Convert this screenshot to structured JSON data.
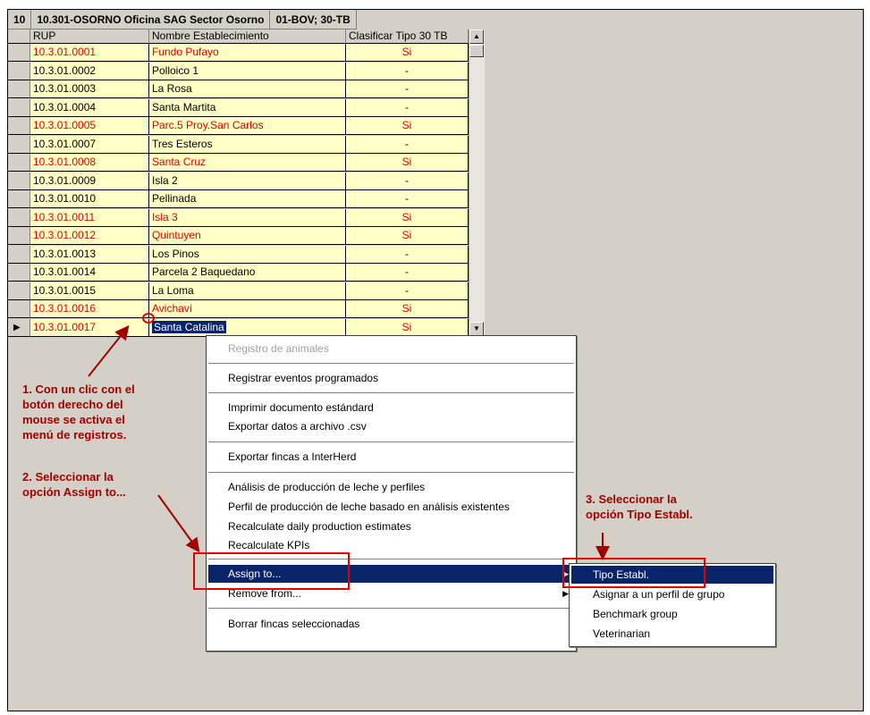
{
  "header": {
    "num": "10",
    "office": "10.301-OSORNO Oficina SAG Sector Osorno",
    "species": "01-BOV; 30-TB"
  },
  "grid": {
    "columns": [
      "RUP",
      "Nombre Establecimiento",
      "Clasificar Tipo 30 TB"
    ],
    "rows": [
      {
        "rup": "10.3.01.0001",
        "name": "Fundo Pufayo",
        "tipo": "Si",
        "color": "#e00000"
      },
      {
        "rup": "10.3.01.0002",
        "name": "Polloico 1",
        "tipo": "-",
        "color": "#000000"
      },
      {
        "rup": "10.3.01.0003",
        "name": "La Rosa",
        "tipo": "-",
        "color": "#000000"
      },
      {
        "rup": "10.3.01.0004",
        "name": "Santa Martita",
        "tipo": "-",
        "color": "#000000"
      },
      {
        "rup": "10.3.01.0005",
        "name": "Parc.5 Proy.San Carlos",
        "tipo": "Si",
        "color": "#e00000"
      },
      {
        "rup": "10.3.01.0007",
        "name": "Tres Esteros",
        "tipo": "-",
        "color": "#000000"
      },
      {
        "rup": "10.3.01.0008",
        "name": "Santa Cruz",
        "tipo": "Si",
        "color": "#e00000"
      },
      {
        "rup": "10.3.01.0009",
        "name": "Isla 2",
        "tipo": "-",
        "color": "#000000"
      },
      {
        "rup": "10.3.01.0010",
        "name": "Pellinada",
        "tipo": "-",
        "color": "#000000"
      },
      {
        "rup": "10.3.01.0011",
        "name": "Isla 3",
        "tipo": "Si",
        "color": "#e00000"
      },
      {
        "rup": "10.3.01.0012",
        "name": "Quintuyen",
        "tipo": "Si",
        "color": "#e00000"
      },
      {
        "rup": "10.3.01.0013",
        "name": "Los Pinos",
        "tipo": "-",
        "color": "#000000"
      },
      {
        "rup": "10.3.01.0014",
        "name": "Parcela 2 Baquedano",
        "tipo": "-",
        "color": "#000000"
      },
      {
        "rup": "10.3.01.0015",
        "name": "La Loma",
        "tipo": "-",
        "color": "#000000"
      },
      {
        "rup": "10.3.01.0016",
        "name": "Avichaví",
        "tipo": "Si",
        "color": "#e00000"
      },
      {
        "rup": "10.3.01.0017",
        "name": "Santa Catalina",
        "tipo": "Si",
        "color": "#e00000",
        "current": true
      }
    ]
  },
  "context_menu": {
    "items": {
      "registro": "Registro de animales",
      "eventos": "Registrar eventos programados",
      "imprimir": "Imprimir documento estándard",
      "exportar_csv": "Exportar datos a archivo .csv",
      "interherd": "Exportar fincas a InterHerd",
      "analisis": "Análisis de producción de leche y perfiles",
      "perfil": "Perfil de producción de leche basado en análisis existentes",
      "recalc_daily": "Recalculate daily production estimates",
      "recalc_kpi": "Recalculate KPIs",
      "assign": "Assign to...",
      "remove": "Remove from...",
      "borrar": "Borrar fincas seleccionadas"
    }
  },
  "submenu": {
    "items": {
      "tipo": "Tipo Establ.",
      "asignar": "Asignar a un perfil de grupo",
      "benchmark": "Benchmark group",
      "vet": "Veterinarian"
    }
  },
  "annotations": {
    "step1": [
      "1. Con un clic con el",
      "botón derecho del",
      "mouse se activa el",
      "menú de registros."
    ],
    "step2": [
      "2. Seleccionar la",
      "opción Assign to..."
    ],
    "step3": [
      "3. Seleccionar la",
      "opción Tipo Establ."
    ]
  },
  "colors": {
    "highlight": "#0a246a",
    "row_bg": "#ffffc6",
    "annotation": "#a00000",
    "marker": "#e00000"
  }
}
